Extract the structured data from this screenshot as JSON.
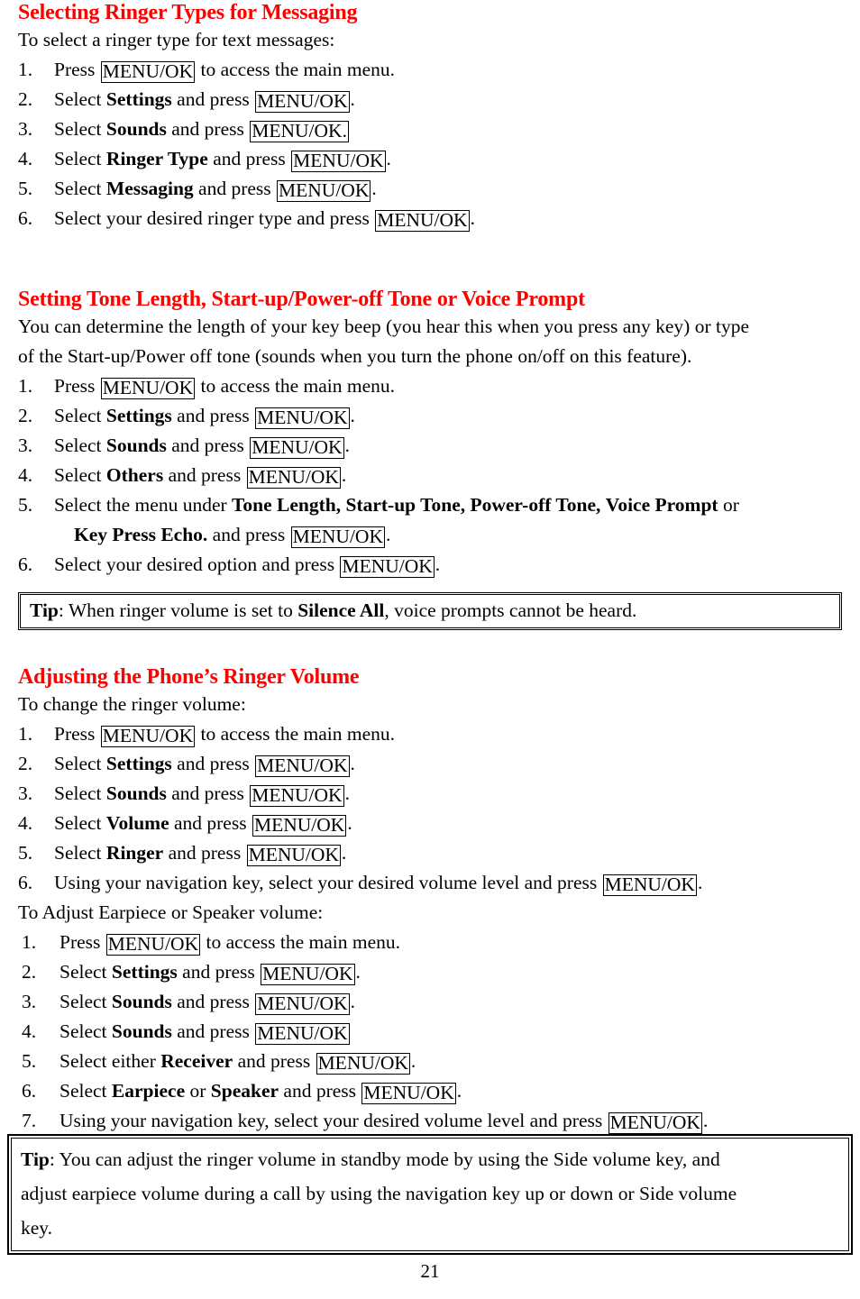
{
  "document": {
    "page_number": "21",
    "heading_color": "#ff0000",
    "key_label": "MENU/OK"
  },
  "sections": [
    {
      "id": "selecting-ringer-types",
      "heading": "Selecting Ringer Types for Messaging",
      "intro": "To select a ringer type for text messages:",
      "steps": [
        {
          "num": "1.",
          "pre": "Press ",
          "key": "MENU/OK",
          "post": " to access the main menu."
        },
        {
          "num": "2.",
          "pre": "Select ",
          "bold": "Settings",
          "mid": " and press ",
          "key": "MENU/OK",
          "post": "."
        },
        {
          "num": "3.",
          "pre": "Select ",
          "bold": "Sounds",
          "mid": " and press ",
          "key": "MENU/OK.",
          "post": ""
        },
        {
          "num": "4.",
          "pre": "Select ",
          "bold": "Ringer Type",
          "mid": " and press ",
          "key": "MENU/OK",
          "post": "."
        },
        {
          "num": "5.",
          "pre": "Select ",
          "bold": "Messaging",
          "mid": " and press ",
          "key": "MENU/OK",
          "post": "."
        },
        {
          "num": "6.",
          "pre": "Select your desired ringer type and press ",
          "key": "MENU/OK",
          "post": "."
        }
      ]
    },
    {
      "id": "setting-tone-length",
      "heading": "Setting Tone Length, Start-up/Power-off Tone or Voice Prompt",
      "intro_line1": "You can determine the length of your key beep (you hear this when you press any key) or type",
      "intro_line2": "of the Start-up/Power off tone (sounds when you turn the phone on/off on this feature).",
      "steps": [
        {
          "num": "1.",
          "pre": "Press ",
          "key": "MENU/OK",
          "post": " to access the main menu."
        },
        {
          "num": "2.",
          "pre": "Select ",
          "bold": "Settings",
          "mid": " and press ",
          "key": "MENU/OK",
          "post": "."
        },
        {
          "num": "3.",
          "pre": "Select ",
          "bold": "Sounds",
          "mid": " and press ",
          "key": "MENU/OK",
          "post": "."
        },
        {
          "num": "4.",
          "pre": "Select ",
          "bold": "Others",
          "mid": " and press ",
          "key": "MENU/OK",
          "post": "."
        }
      ],
      "step5": {
        "num": "5.",
        "pre": "Select the menu under ",
        "terms": [
          "Tone Length",
          "Start-up Tone",
          "Power-off Tone",
          "Voice Prompt"
        ],
        "or": " or",
        "cont_bold": "Key Press Echo.",
        "cont_mid": " and press ",
        "cont_key": "MENU/OK",
        "cont_post": "."
      },
      "step6": {
        "num": "6.",
        "pre": "Select your desired option and press ",
        "key": "MENU/OK",
        "post": "."
      }
    },
    {
      "id": "adjusting-ringer-volume",
      "heading": "Adjusting the Phone’s Ringer Volume",
      "intro": "To change the ringer volume:",
      "steps": [
        {
          "num": "1.",
          "pre": "Press ",
          "key": "MENU/OK",
          "post": " to access the main menu."
        },
        {
          "num": "2.",
          "pre": "Select ",
          "bold": "Settings",
          "mid": " and press ",
          "key": "MENU/OK",
          "post": "."
        },
        {
          "num": "3.",
          "pre": "Select ",
          "bold": "Sounds",
          "mid": " and press ",
          "key": "MENU/OK",
          "post": "."
        },
        {
          "num": "4.",
          "pre": "Select ",
          "bold": "Volume",
          "mid": " and press ",
          "key": "MENU/OK",
          "post": "."
        },
        {
          "num": "5.",
          "pre": "Select ",
          "bold": "Ringer",
          "mid": " and press ",
          "key": "MENU/OK",
          "post": "."
        },
        {
          "num": "6.",
          "pre": "Using your navigation key, select your desired volume level and press ",
          "key": "MENU/OK",
          "post": "."
        }
      ],
      "subintro": "To Adjust Earpiece or Speaker volume:",
      "substeps": [
        {
          "num": "1.",
          "pre": "Press ",
          "key": "MENU/OK",
          "post": " to access the main menu."
        },
        {
          "num": "2.",
          "pre": "Select ",
          "bold": "Settings",
          "mid": " and press ",
          "key": "MENU/OK",
          "post": "."
        },
        {
          "num": "3.",
          "pre": "Select ",
          "bold": "Sounds",
          "mid": " and press ",
          "key": "MENU/OK",
          "post": "."
        },
        {
          "num": "4.",
          "pre": "Select ",
          "bold": "Sounds",
          "mid": " and press ",
          "key": "MENU/OK",
          "post": ""
        },
        {
          "num": "5.",
          "pre": "Select either ",
          "bold": "Receiver",
          "mid": " and press ",
          "key": "MENU/OK",
          "post": "."
        },
        {
          "num": "6.",
          "pre": "Select ",
          "bold": "Earpiece",
          "mid": " or ",
          "bold2": "Speaker",
          "mid2": " and press ",
          "key": "MENU/OK",
          "post": "."
        },
        {
          "num": "7.",
          "pre": "Using your navigation key, select your desired volume level and press ",
          "key": "MENU/OK",
          "post": "."
        }
      ]
    }
  ],
  "tips": [
    {
      "id": "tip-silence-all",
      "label": "Tip",
      "pre": ": When ringer volume is set to ",
      "bold": "Silence All",
      "post": ", voice prompts cannot be heard."
    },
    {
      "id": "tip-side-volume-key",
      "label": "Tip",
      "line1": ": You can adjust the ringer volume in standby mode by using the Side volume key, and",
      "line2": "adjust earpiece volume during a call by using the navigation key up or down or Side volume",
      "line3": "key."
    }
  ]
}
